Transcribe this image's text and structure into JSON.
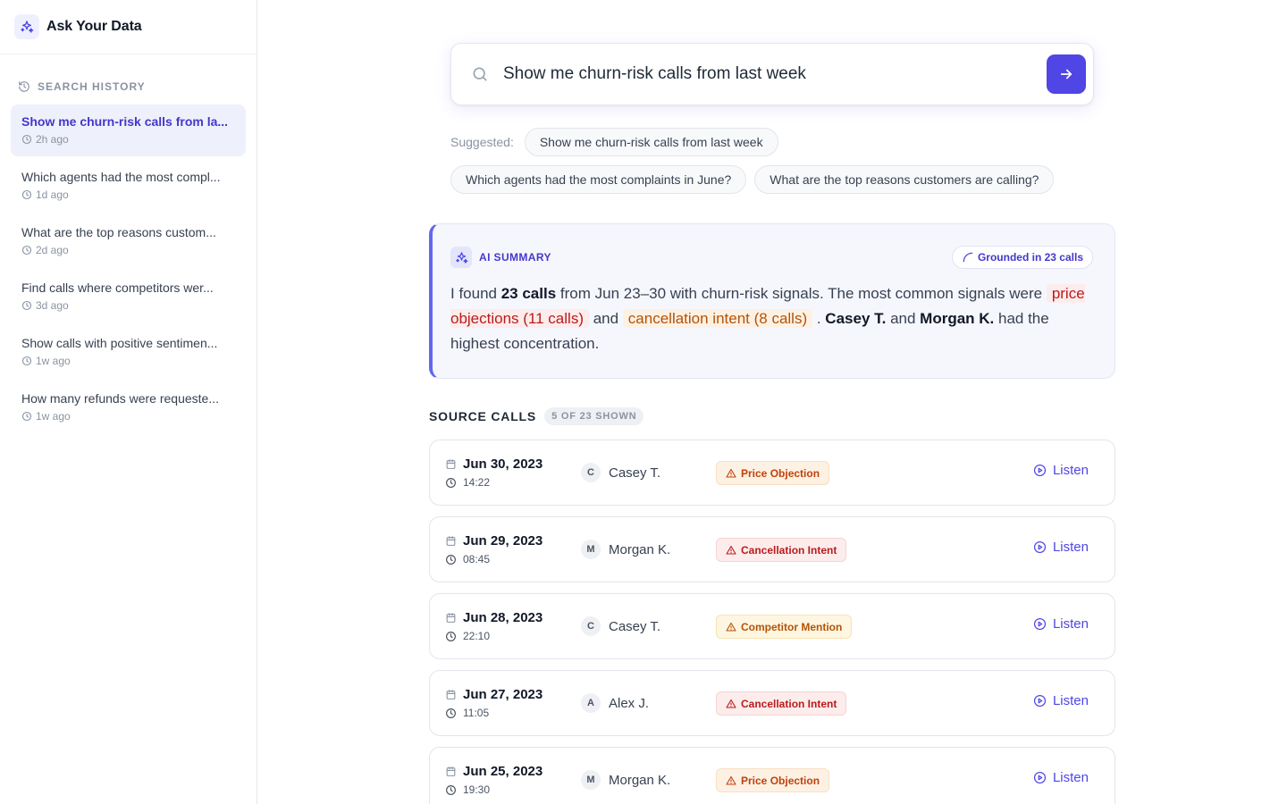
{
  "app": {
    "title": "Ask Your Data"
  },
  "sidebar": {
    "history_label": "SEARCH HISTORY",
    "items": [
      {
        "query": "Show me churn-risk calls from la...",
        "time": "2h ago",
        "active": true
      },
      {
        "query": "Which agents had the most compl...",
        "time": "1d ago"
      },
      {
        "query": "What are the top reasons custom...",
        "time": "2d ago"
      },
      {
        "query": "Find calls where competitors wer...",
        "time": "3d ago"
      },
      {
        "query": "Show calls with positive sentimen...",
        "time": "1w ago"
      },
      {
        "query": "How many refunds were requeste...",
        "time": "1w ago"
      }
    ]
  },
  "search": {
    "value": "Show me churn-risk calls from last week"
  },
  "suggested": {
    "label": "Suggested:",
    "chips": [
      "Show me churn-risk calls from last week",
      "Which agents had the most complaints in June?",
      "What are the top reasons customers are calling?"
    ]
  },
  "summary": {
    "label": "AI SUMMARY",
    "grounded": "Grounded in 23 calls",
    "t1": "I found ",
    "b1": "23 calls",
    "t2": " from Jun 23–30 with churn-risk signals. The most common signals were ",
    "h1": "price objections (11 calls)",
    "t3": " and ",
    "h2": "cancellation intent (8 calls)",
    "t4": " . ",
    "b2": "Casey T.",
    "t5": " and ",
    "b3": "Morgan K.",
    "t6": " had the highest concentration."
  },
  "calls": {
    "title": "SOURCE CALLS",
    "count": "5 OF 23 SHOWN",
    "listen_label": "Listen",
    "rows": [
      {
        "date": "Jun 30, 2023",
        "time": "14:22",
        "initial": "C",
        "agent": "Casey T.",
        "tag": "Price Objection"
      },
      {
        "date": "Jun 29, 2023",
        "time": "08:45",
        "initial": "M",
        "agent": "Morgan K.",
        "tag": "Cancellation Intent"
      },
      {
        "date": "Jun 28, 2023",
        "time": "22:10",
        "initial": "C",
        "agent": "Casey T.",
        "tag": "Competitor Mention"
      },
      {
        "date": "Jun 27, 2023",
        "time": "11:05",
        "initial": "A",
        "agent": "Alex J.",
        "tag": "Cancellation Intent"
      },
      {
        "date": "Jun 25, 2023",
        "time": "19:30",
        "initial": "M",
        "agent": "Morgan K.",
        "tag": "Price Objection"
      }
    ]
  },
  "colors": {
    "accent": "#4f46e5",
    "price_tag": "#c2410c",
    "cancel_tag": "#b91c1c",
    "competitor_tag": "#b45309"
  }
}
